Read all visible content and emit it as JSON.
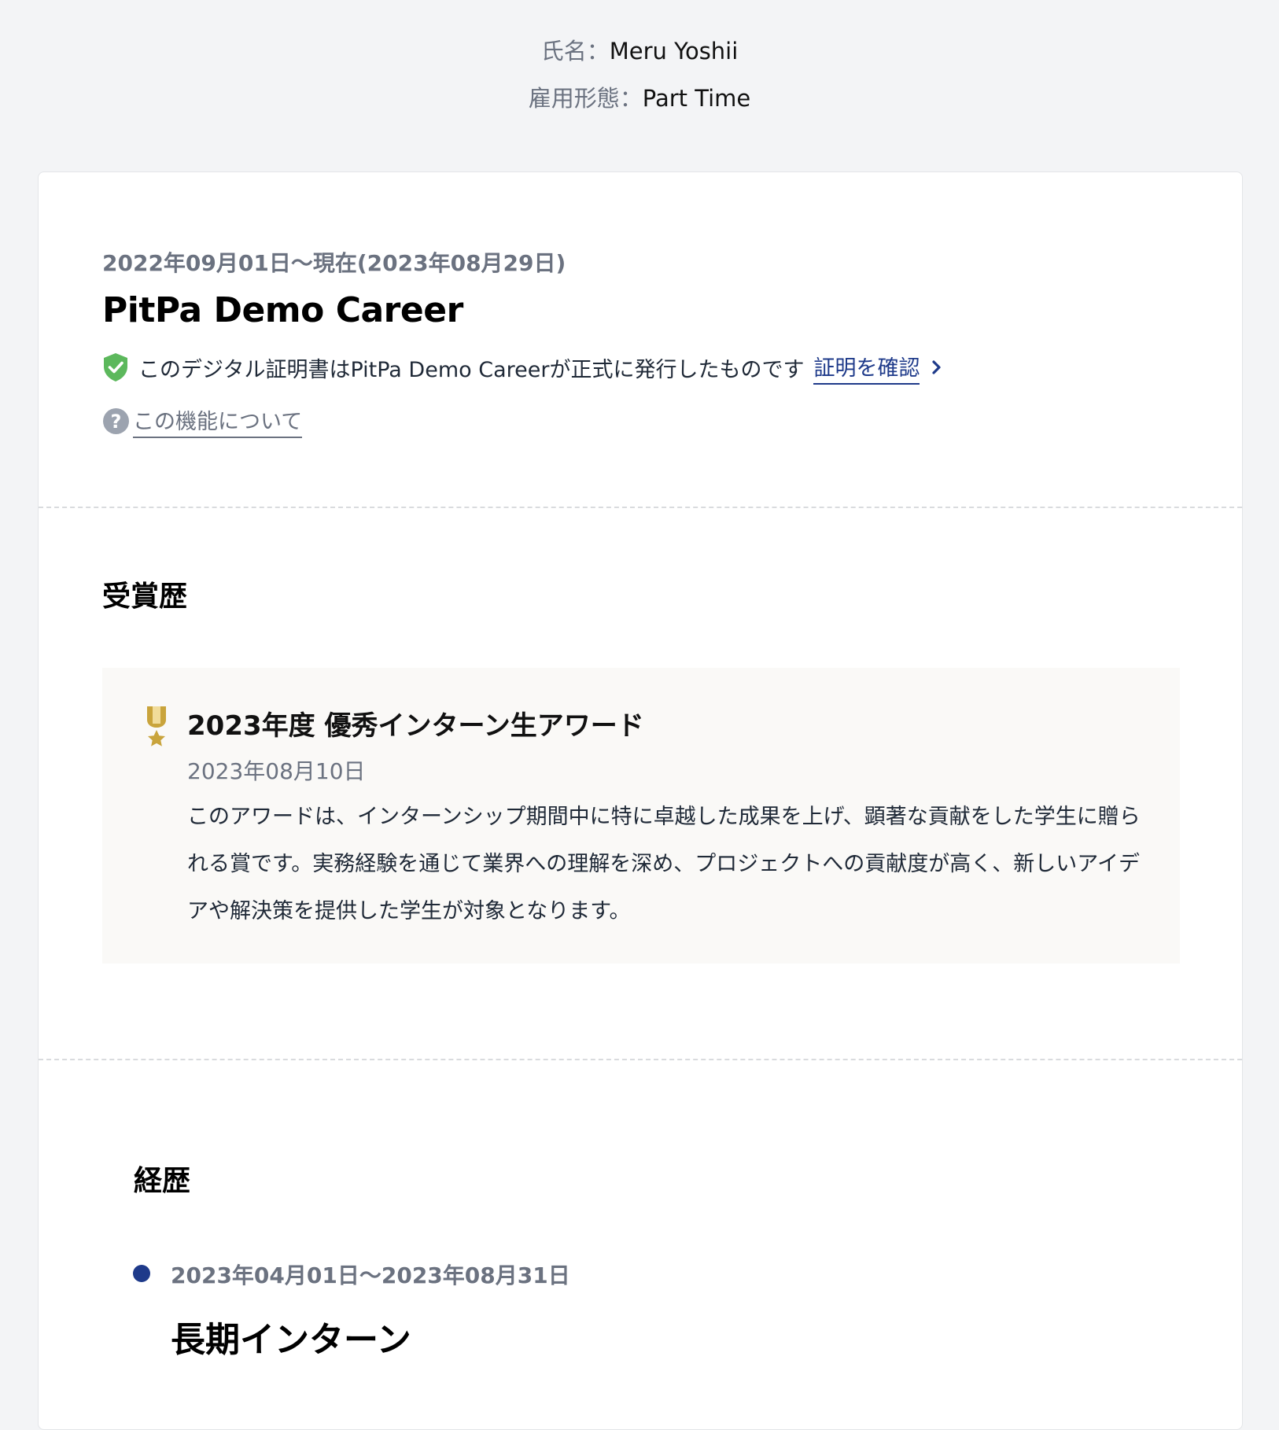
{
  "profile": {
    "name_label": "氏名：",
    "name_value": "Meru Yoshii",
    "employment_label": "雇用形態：",
    "employment_value": "Part Time"
  },
  "certificate": {
    "period": "2022年09月01日〜現在(2023年08月29日)",
    "company": "PitPa Demo Career",
    "verify_text": "このデジタル証明書はPitPa Demo Careerが正式に発行したものです",
    "verify_link": "証明を確認",
    "about_link": "この機能について",
    "shield_icon": "shield-check-icon",
    "question_icon": "question-circle-icon"
  },
  "awards": {
    "heading": "受賞歴",
    "items": [
      {
        "title": "2023年度 優秀インターン生アワード",
        "date": "2023年08月10日",
        "description": "このアワードは、インターンシップ期間中に特に卓越した成果を上げ、顕著な貢献をした学生に贈られる賞です。実務経験を通じて業界への理解を深め、プロジェクトへの貢献度が高く、新しいアイデアや解決策を提供した学生が対象となります。",
        "icon": "medal-icon"
      }
    ]
  },
  "career": {
    "heading": "経歴",
    "items": [
      {
        "period": "2023年04月01日〜2023年08月31日",
        "title": "長期インターン"
      }
    ]
  },
  "colors": {
    "background": "#f3f4f6",
    "card": "#ffffff",
    "link": "#1e3a8a",
    "muted": "#6b7280",
    "shield": "#5cb85c",
    "medal": "#c9a43c",
    "timeline_dot": "#1e3a8a",
    "award_bg": "#faf9f7"
  }
}
